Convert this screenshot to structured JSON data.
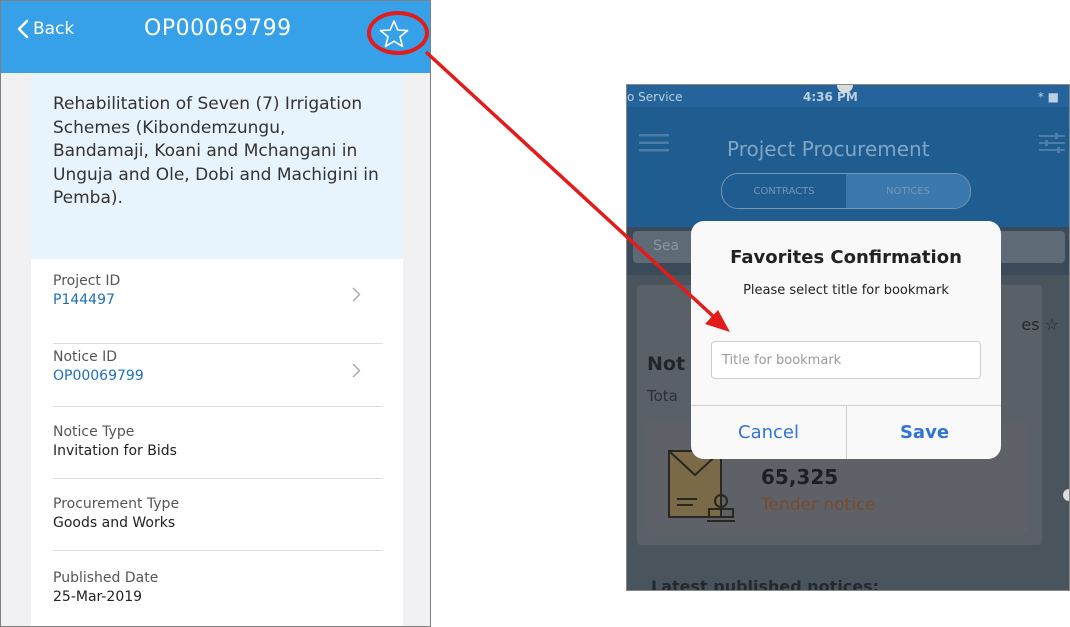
{
  "left": {
    "header": {
      "back_label": "Back",
      "title": "OP00069799",
      "color": "#36a1e8"
    },
    "project_title": "Rehabilitation of Seven (7) Irrigation Schemes (Kibondemzungu, Bandamaji, Koani and Mchangani in Unguja and Ole, Dobi and Machigini in Pemba).",
    "fields": [
      {
        "label": "Project ID",
        "value": "P144497"
      },
      {
        "label": "Notice ID",
        "value": "OP00069799"
      },
      {
        "label": "Notice Type",
        "value": "Invitation for Bids"
      },
      {
        "label": "Procurement Type",
        "value": "Goods and Works"
      },
      {
        "label": "Published Date",
        "value": "25-Mar-2019"
      }
    ],
    "icons": {
      "back": "chevron-left-icon",
      "favorite": "star-outline-icon",
      "row": "chevron-right-icon"
    }
  },
  "right": {
    "status_bar": {
      "service": "o Service",
      "time": "4:36 PM",
      "right": "* ■"
    },
    "app_title": "Project Procurement",
    "segments": [
      "CONTRACTS",
      "NOTICES"
    ],
    "selected_segment": "NOTICES",
    "search_placeholder_partial": "Sea",
    "background": {
      "notices_partial": "Not",
      "total_partial": "Tota",
      "favorites_partial": "es ☆",
      "count": "65,325",
      "count_label": "Tender notice",
      "latest_partial": "Latest published notices:"
    },
    "dialog": {
      "title": "Favorites Confirmation",
      "message": "Please select title for bookmark",
      "input_placeholder": "Title for bookmark",
      "input_value": "",
      "cancel_label": "Cancel",
      "save_label": "Save"
    }
  },
  "colors": {
    "annotation_red": "#e21b1b",
    "link_blue": "#1e70b7",
    "dialog_button_blue": "#2f74d6"
  }
}
